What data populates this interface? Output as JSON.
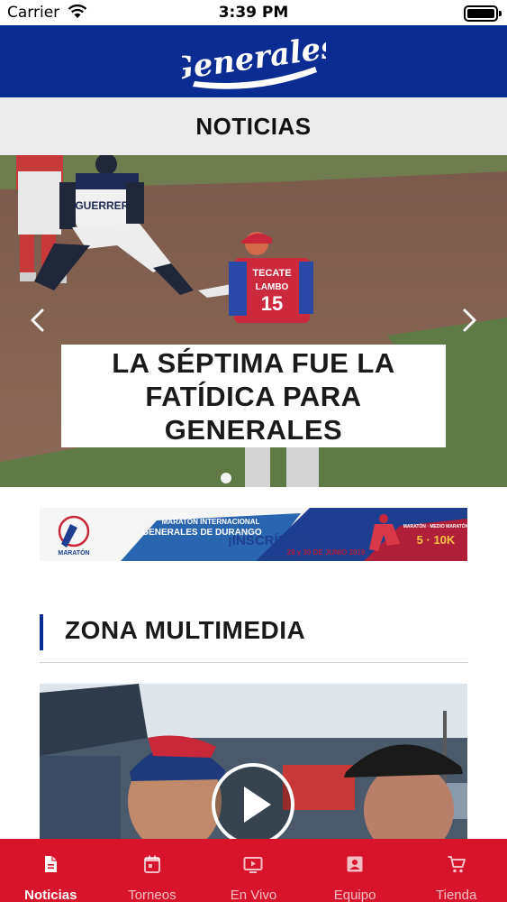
{
  "status_bar": {
    "carrier": "Carrier",
    "time": "3:39 PM"
  },
  "header": {
    "logo_text": "Generales"
  },
  "section": {
    "title": "NOTICIAS"
  },
  "hero": {
    "caption": "LA SÉPTIMA FUE LA FATÍDICA PARA GENERALES",
    "jersey_brand": "TECATE",
    "jersey_name": "LAMBO",
    "jersey_number": "15",
    "jersey_front": "GUERRERO"
  },
  "ad": {
    "logo_text": "MARATÓN",
    "line1": "MARATÓN INTERNACIONAL",
    "line2": "GENERALES DE DURANGO",
    "cta": "¡INSCRÍBITE YA!",
    "dates": "29 y 30 DE JUNIO 2019",
    "distance": "5 · 10K",
    "badge": "MARATÓN · MEDIO MARATÓN"
  },
  "multimedia": {
    "title": "ZONA MULTIMEDIA"
  },
  "tabs": [
    {
      "label": "Noticias",
      "icon": "document-icon",
      "active": true
    },
    {
      "label": "Torneos",
      "icon": "calendar-icon",
      "active": false
    },
    {
      "label": "En Vivo",
      "icon": "tv-play-icon",
      "active": false
    },
    {
      "label": "Equipo",
      "icon": "contact-card-icon",
      "active": false
    },
    {
      "label": "Tienda",
      "icon": "cart-icon",
      "active": false
    }
  ],
  "colors": {
    "brand_blue": "#0a2c93",
    "tab_red": "#d7142a",
    "section_gray": "#ececec"
  }
}
